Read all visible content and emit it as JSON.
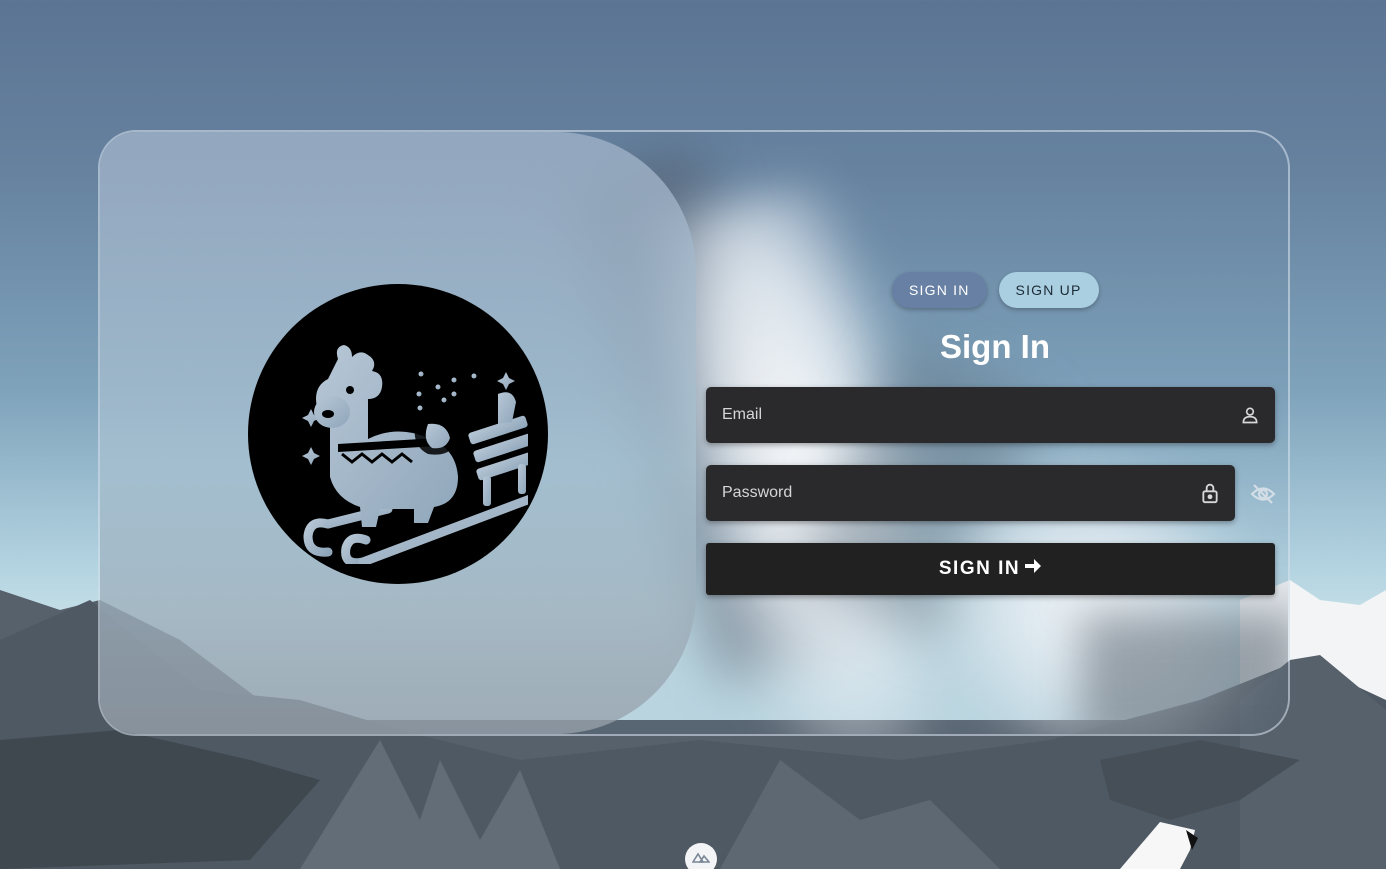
{
  "auth": {
    "tabs": [
      {
        "label": "SIGN IN",
        "active": true
      },
      {
        "label": "SIGN UP",
        "active": false
      }
    ],
    "title": "Sign In",
    "email": {
      "placeholder": "Email",
      "value": "",
      "icon": "person-icon"
    },
    "password": {
      "placeholder": "Password",
      "value": "",
      "icon": "lock-icon",
      "toggle_icon": "eye-off-icon"
    },
    "submit_label": "SIGN IN",
    "submit_icon": "arrow-right-icon"
  },
  "branding": {
    "logo": "llama-on-sled-logo",
    "footer_badge_icon": "nuxt-icon"
  },
  "colors": {
    "tab_active": "#6780a3",
    "tab_inactive": "#a9cfe0",
    "field_bg": "#2a2a2c",
    "button_bg": "#212121",
    "sky_top": "#5c7494"
  }
}
